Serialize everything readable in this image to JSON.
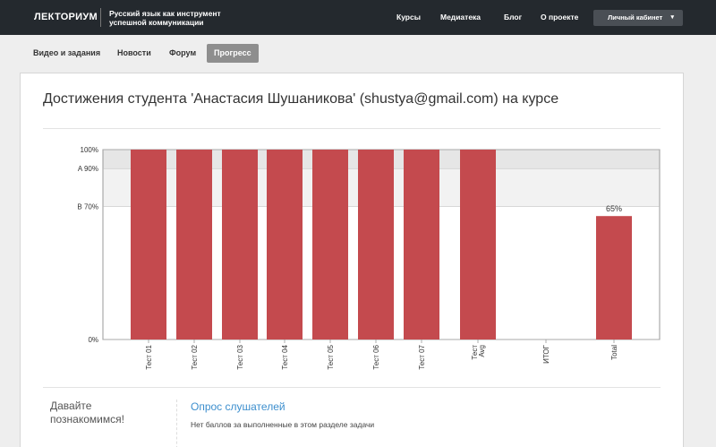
{
  "header": {
    "logo": "ЛЕКТОРИУМ",
    "tagline": "Русский язык как инструмент успешной коммуникации",
    "nav": [
      "Курсы",
      "Медиатека",
      "Блог",
      "О проекте"
    ],
    "cabinet_label": "Личный кабинет",
    "cabinet_caret": "▾"
  },
  "tabs": [
    {
      "label": "Видео и задания",
      "active": false
    },
    {
      "label": "Новости",
      "active": false
    },
    {
      "label": "Форум",
      "active": false
    },
    {
      "label": "Прогресс",
      "active": true
    }
  ],
  "page_title": "Достижения студента 'Анастасия Шушаникова' (shustya@gmail.com) на курсе",
  "colors": {
    "topbar": "#24292e",
    "bar": "#c44a4e",
    "band_a": "#e6e6e6",
    "band_b": "#f2f2f2",
    "link": "#3d8fce",
    "active_tab": "#8e8e8e"
  },
  "chart_data": {
    "type": "bar",
    "categories": [
      "Тест 01",
      "Тест 02",
      "Тест 03",
      "Тест 04",
      "Тест 05",
      "Тест 06",
      "Тест 07",
      "Тест Avg",
      "ИТОГ",
      "Total"
    ],
    "values": [
      100,
      100,
      100,
      100,
      100,
      100,
      100,
      100,
      null,
      65
    ],
    "value_labels": {
      "Total": "65%"
    },
    "y_ticks": [
      {
        "value": 100,
        "label": "100%"
      },
      {
        "value": 90,
        "label": "A 90%"
      },
      {
        "value": 70,
        "label": "B 70%"
      },
      {
        "value": 0,
        "label": "0%"
      }
    ],
    "grade_bands": [
      {
        "from": 90,
        "to": 100,
        "grade": "A"
      },
      {
        "from": 70,
        "to": 90,
        "grade": "B"
      }
    ],
    "ylim": [
      0,
      100
    ],
    "title": "",
    "xlabel": "",
    "ylabel": ""
  },
  "section": {
    "intro": "Давайте познакомимся!",
    "link": "Опрос слушателей",
    "note": "Нет баллов за выполненные в этом разделе задачи"
  }
}
